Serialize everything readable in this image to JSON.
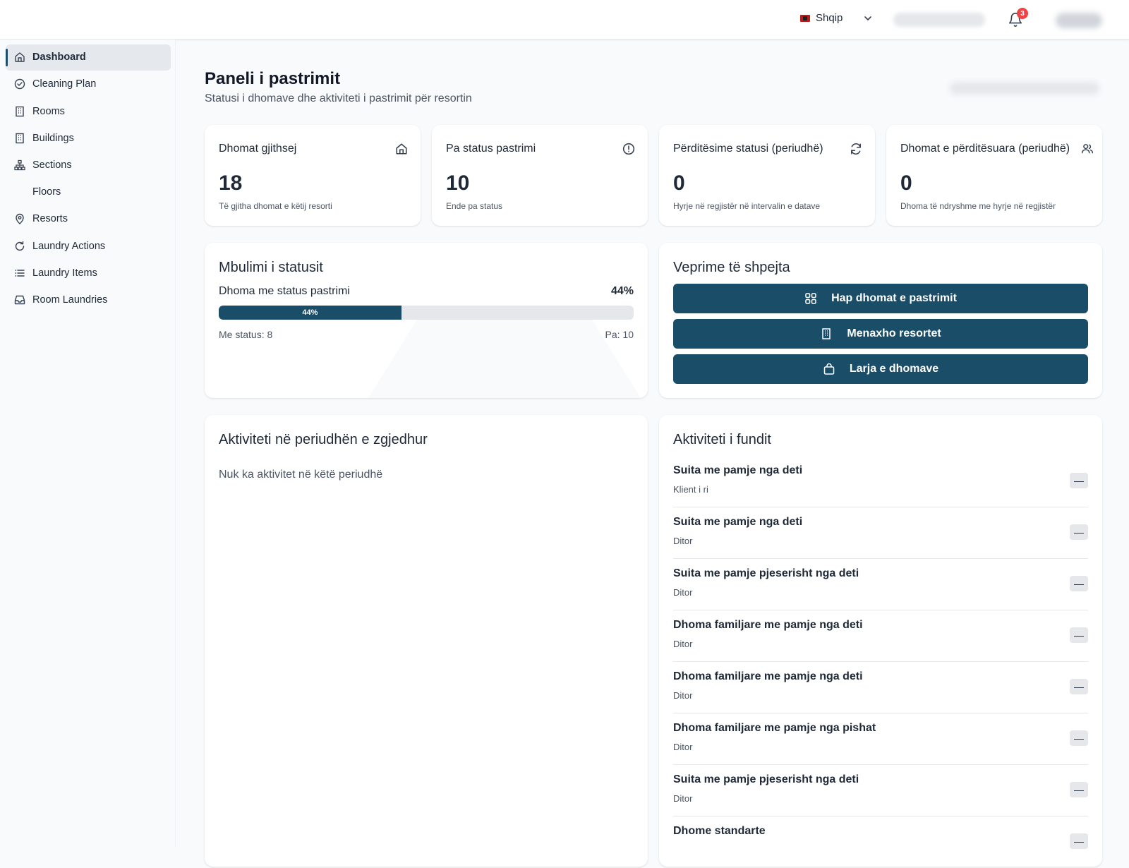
{
  "topbar": {
    "language": "Shqip",
    "notification_count": "3"
  },
  "sidebar": {
    "items": [
      {
        "label": "Dashboard",
        "icon": "home-icon"
      },
      {
        "label": "Cleaning Plan",
        "icon": "check-circle-icon"
      },
      {
        "label": "Rooms",
        "icon": "building-icon"
      },
      {
        "label": "Buildings",
        "icon": "building-icon"
      },
      {
        "label": "Sections",
        "icon": "sitemap-icon"
      },
      {
        "label": "Floors",
        "icon": ""
      },
      {
        "label": "Resorts",
        "icon": "map-pin-icon"
      },
      {
        "label": "Laundry Actions",
        "icon": "refresh-icon"
      },
      {
        "label": "Laundry Items",
        "icon": "list-icon"
      },
      {
        "label": "Room Laundries",
        "icon": "inbox-icon"
      }
    ]
  },
  "page": {
    "title": "Paneli i pastrimit",
    "subtitle": "Statusi i dhomave dhe aktiviteti i pastrimit për resortin"
  },
  "stats": [
    {
      "title": "Dhomat gjithsej",
      "value": "18",
      "desc": "Të gjitha dhomat e këtij resorti",
      "icon": "home-icon"
    },
    {
      "title": "Pa status pastrimi",
      "value": "10",
      "desc": "Ende pa status",
      "icon": "alert-circle-icon"
    },
    {
      "title": "Përditësime statusi (periudhë)",
      "value": "0",
      "desc": "Hyrje në regjistër në intervalin e datave",
      "icon": "refresh-icon"
    },
    {
      "title": "Dhomat e përditësuara (periudhë)",
      "value": "0",
      "desc": "Dhoma të ndryshme me hyrje në regjistër",
      "icon": "users-icon"
    }
  ],
  "coverage": {
    "title": "Mbulimi i statusit",
    "label": "Dhoma me status pastrimi",
    "percent_text": "44%",
    "percent": 44,
    "with_status": "Me status: 8",
    "without_status": "Pa: 10"
  },
  "quick_actions": {
    "title": "Veprime të shpejta",
    "buttons": [
      {
        "label": "Hap dhomat e pastrimit",
        "icon": "grid-icon"
      },
      {
        "label": "Menaxho resortet",
        "icon": "building-icon"
      },
      {
        "label": "Larja e dhomave",
        "icon": "bag-icon"
      }
    ]
  },
  "period_activity": {
    "title": "Aktiviteti në periudhën e zgjedhur",
    "empty": "Nuk ka aktivitet në këtë periudhë"
  },
  "recent_activity": {
    "title": "Aktiviteti i fundit",
    "items": [
      {
        "title": "Suita me pamje nga deti",
        "sub": "Klient i ri",
        "dash": "—"
      },
      {
        "title": "Suita me pamje nga deti",
        "sub": "Ditor",
        "dash": "—"
      },
      {
        "title": "Suita me pamje pjeserisht nga deti",
        "sub": "Ditor",
        "dash": "—"
      },
      {
        "title": "Dhoma familjare me pamje nga deti",
        "sub": "Ditor",
        "dash": "—"
      },
      {
        "title": "Dhoma familjare me pamje nga deti",
        "sub": "Ditor",
        "dash": "—"
      },
      {
        "title": "Dhoma familjare me pamje nga pishat",
        "sub": "Ditor",
        "dash": "—"
      },
      {
        "title": "Suita me pamje pjeserisht nga deti",
        "sub": "Ditor",
        "dash": "—"
      },
      {
        "title": "Dhome standarte",
        "sub": "",
        "dash": "—"
      }
    ]
  },
  "colors": {
    "primary": "#1a4d68",
    "badge": "#ef4444",
    "background": "#f8fafc"
  }
}
